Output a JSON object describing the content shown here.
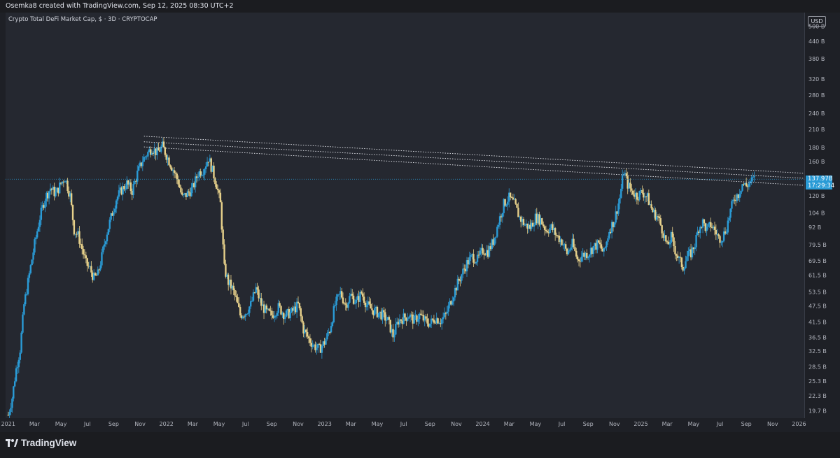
{
  "header": {
    "caption": "Osemka8 created with TradingView.com, Sep 12, 2025 08:30 UTC+2"
  },
  "chart_header": {
    "symbol_line": "Crypto Total DeFi Market Cap, $ · 3D · CRYPTOCAP"
  },
  "currency_button": "USD",
  "last_price": {
    "value": "137.97B",
    "countdown": "17:29:34"
  },
  "branding": {
    "logo_text": "TradingView"
  },
  "colors": {
    "up": "#2a9bd6",
    "down": "#e6d08a",
    "background": "#252830",
    "price_line": "#2a9bd6"
  },
  "chart_data": {
    "type": "candlestick",
    "title": "Crypto Total DeFi Market Cap, $ · 3D · CRYPTOCAP",
    "y_scale": "log",
    "ylim": [
      18.5,
      560
    ],
    "y_ticks": [
      {
        "value": 500,
        "label": "500 B"
      },
      {
        "value": 440,
        "label": "440 B"
      },
      {
        "value": 380,
        "label": "380 B"
      },
      {
        "value": 320,
        "label": "320 B"
      },
      {
        "value": 280,
        "label": "280 B"
      },
      {
        "value": 240,
        "label": "240 B"
      },
      {
        "value": 210,
        "label": "210 B"
      },
      {
        "value": 180,
        "label": "180 B"
      },
      {
        "value": 160,
        "label": "160 B"
      },
      {
        "value": 120,
        "label": "120 B"
      },
      {
        "value": 104,
        "label": "104 B"
      },
      {
        "value": 92,
        "label": "92 B"
      },
      {
        "value": 79.5,
        "label": "79.5 B"
      },
      {
        "value": 69.5,
        "label": "69.5 B"
      },
      {
        "value": 61.5,
        "label": "61.5 B"
      },
      {
        "value": 53.5,
        "label": "53.5 B"
      },
      {
        "value": 47.5,
        "label": "47.5 B"
      },
      {
        "value": 41.5,
        "label": "41.5 B"
      },
      {
        "value": 36.5,
        "label": "36.5 B"
      },
      {
        "value": 32.5,
        "label": "32.5 B"
      },
      {
        "value": 28.5,
        "label": "28.5 B"
      },
      {
        "value": 25.3,
        "label": "25.3 B"
      },
      {
        "value": 22.3,
        "label": "22.3 B"
      },
      {
        "value": 19.7,
        "label": "19.7 B"
      }
    ],
    "x_ticks": [
      {
        "t": 0,
        "label": "2021"
      },
      {
        "t": 2,
        "label": "Mar"
      },
      {
        "t": 4,
        "label": "May"
      },
      {
        "t": 6,
        "label": "Jul"
      },
      {
        "t": 8,
        "label": "Sep"
      },
      {
        "t": 10,
        "label": "Nov"
      },
      {
        "t": 12,
        "label": "2022"
      },
      {
        "t": 14,
        "label": "Mar"
      },
      {
        "t": 16,
        "label": "May"
      },
      {
        "t": 18,
        "label": "Jul"
      },
      {
        "t": 20,
        "label": "Sep"
      },
      {
        "t": 22,
        "label": "Nov"
      },
      {
        "t": 24,
        "label": "2023"
      },
      {
        "t": 26,
        "label": "Mar"
      },
      {
        "t": 28,
        "label": "May"
      },
      {
        "t": 30,
        "label": "Jul"
      },
      {
        "t": 32,
        "label": "Sep"
      },
      {
        "t": 34,
        "label": "Nov"
      },
      {
        "t": 36,
        "label": "2024"
      },
      {
        "t": 38,
        "label": "Mar"
      },
      {
        "t": 40,
        "label": "May"
      },
      {
        "t": 42,
        "label": "Jul"
      },
      {
        "t": 44,
        "label": "Sep"
      },
      {
        "t": 46,
        "label": "Nov"
      },
      {
        "t": 48,
        "label": "2025"
      },
      {
        "t": 50,
        "label": "Mar"
      },
      {
        "t": 52,
        "label": "May"
      },
      {
        "t": 54,
        "label": "Jul"
      },
      {
        "t": 56,
        "label": "Sep"
      },
      {
        "t": 58,
        "label": "Nov"
      },
      {
        "t": 60,
        "label": "2026"
      }
    ],
    "xlim": [
      -0.2,
      60.4
    ],
    "price_anchors": [
      [
        0.0,
        19
      ],
      [
        0.3,
        22
      ],
      [
        0.6,
        28
      ],
      [
        0.9,
        33
      ],
      [
        1.2,
        48
      ],
      [
        1.6,
        62
      ],
      [
        2.0,
        80
      ],
      [
        2.4,
        100
      ],
      [
        2.8,
        118
      ],
      [
        3.2,
        128
      ],
      [
        3.6,
        122
      ],
      [
        4.0,
        133
      ],
      [
        4.3,
        140
      ],
      [
        4.7,
        120
      ],
      [
        5.0,
        90
      ],
      [
        5.3,
        86
      ],
      [
        5.6,
        77
      ],
      [
        5.9,
        68
      ],
      [
        6.2,
        65
      ],
      [
        6.5,
        60
      ],
      [
        6.8,
        62
      ],
      [
        7.1,
        72
      ],
      [
        7.4,
        85
      ],
      [
        7.8,
        100
      ],
      [
        8.2,
        117
      ],
      [
        8.6,
        126
      ],
      [
        9.0,
        133
      ],
      [
        9.4,
        125
      ],
      [
        9.8,
        145
      ],
      [
        10.2,
        162
      ],
      [
        10.5,
        170
      ],
      [
        10.9,
        180
      ],
      [
        11.3,
        172
      ],
      [
        11.7,
        182
      ],
      [
        12.1,
        165
      ],
      [
        12.5,
        150
      ],
      [
        12.9,
        135
      ],
      [
        13.2,
        118
      ],
      [
        13.6,
        122
      ],
      [
        14.0,
        128
      ],
      [
        14.4,
        145
      ],
      [
        14.8,
        150
      ],
      [
        15.2,
        165
      ],
      [
        15.5,
        148
      ],
      [
        15.8,
        132
      ],
      [
        16.1,
        112
      ],
      [
        16.4,
        65
      ],
      [
        16.7,
        58
      ],
      [
        17.0,
        55
      ],
      [
        17.3,
        50
      ],
      [
        17.6,
        44
      ],
      [
        18.0,
        45
      ],
      [
        18.4,
        48
      ],
      [
        18.8,
        55
      ],
      [
        19.2,
        48
      ],
      [
        19.6,
        45
      ],
      [
        20.0,
        44
      ],
      [
        20.5,
        47
      ],
      [
        21.0,
        44
      ],
      [
        21.5,
        45
      ],
      [
        22.0,
        48
      ],
      [
        22.4,
        39
      ],
      [
        22.8,
        36
      ],
      [
        23.2,
        34
      ],
      [
        23.6,
        33
      ],
      [
        24.0,
        35
      ],
      [
        24.4,
        39
      ],
      [
        24.8,
        48
      ],
      [
        25.2,
        53
      ],
      [
        25.6,
        48
      ],
      [
        26.0,
        52
      ],
      [
        26.4,
        49
      ],
      [
        26.8,
        53
      ],
      [
        27.2,
        48
      ],
      [
        27.6,
        46
      ],
      [
        28.0,
        45
      ],
      [
        28.4,
        44
      ],
      [
        28.8,
        42
      ],
      [
        29.2,
        37
      ],
      [
        29.6,
        42
      ],
      [
        30.0,
        43
      ],
      [
        30.4,
        44
      ],
      [
        30.8,
        42
      ],
      [
        31.2,
        44
      ],
      [
        31.6,
        42
      ],
      [
        32.0,
        41
      ],
      [
        32.4,
        43
      ],
      [
        32.8,
        42
      ],
      [
        33.2,
        44
      ],
      [
        33.6,
        50
      ],
      [
        34.0,
        56
      ],
      [
        34.4,
        62
      ],
      [
        34.8,
        68
      ],
      [
        35.2,
        72
      ],
      [
        35.6,
        70
      ],
      [
        36.0,
        76
      ],
      [
        36.4,
        75
      ],
      [
        36.8,
        82
      ],
      [
        37.2,
        96
      ],
      [
        37.6,
        112
      ],
      [
        38.0,
        118
      ],
      [
        38.4,
        112
      ],
      [
        38.8,
        100
      ],
      [
        39.2,
        94
      ],
      [
        39.6,
        92
      ],
      [
        40.0,
        100
      ],
      [
        40.4,
        98
      ],
      [
        40.8,
        90
      ],
      [
        41.2,
        92
      ],
      [
        41.6,
        86
      ],
      [
        42.0,
        82
      ],
      [
        42.4,
        74
      ],
      [
        42.8,
        80
      ],
      [
        43.2,
        70
      ],
      [
        43.6,
        73
      ],
      [
        44.0,
        74
      ],
      [
        44.4,
        78
      ],
      [
        44.8,
        80
      ],
      [
        45.2,
        74
      ],
      [
        45.6,
        90
      ],
      [
        46.0,
        98
      ],
      [
        46.4,
        118
      ],
      [
        46.7,
        148
      ],
      [
        47.0,
        132
      ],
      [
        47.3,
        125
      ],
      [
        47.7,
        120
      ],
      [
        48.1,
        124
      ],
      [
        48.5,
        118
      ],
      [
        48.9,
        105
      ],
      [
        49.3,
        100
      ],
      [
        49.7,
        88
      ],
      [
        50.0,
        78
      ],
      [
        50.3,
        85
      ],
      [
        50.6,
        76
      ],
      [
        50.9,
        70
      ],
      [
        51.2,
        66
      ],
      [
        51.5,
        72
      ],
      [
        51.8,
        74
      ],
      [
        52.1,
        80
      ],
      [
        52.4,
        92
      ],
      [
        52.7,
        96
      ],
      [
        53.0,
        90
      ],
      [
        53.3,
        94
      ],
      [
        53.6,
        90
      ],
      [
        53.9,
        84
      ],
      [
        54.2,
        85
      ],
      [
        54.5,
        92
      ],
      [
        54.8,
        106
      ],
      [
        55.1,
        118
      ],
      [
        55.4,
        122
      ],
      [
        55.7,
        133
      ],
      [
        56.0,
        130
      ],
      [
        56.3,
        135
      ],
      [
        56.6,
        138
      ]
    ],
    "trendlines": [
      {
        "from": [
          10.3,
          198
        ],
        "to": [
          60.4,
          145
        ]
      },
      {
        "from": [
          10.3,
          189
        ],
        "to": [
          60.4,
          139
        ]
      },
      {
        "from": [
          10.3,
          181
        ],
        "to": [
          60.4,
          131
        ]
      }
    ]
  }
}
